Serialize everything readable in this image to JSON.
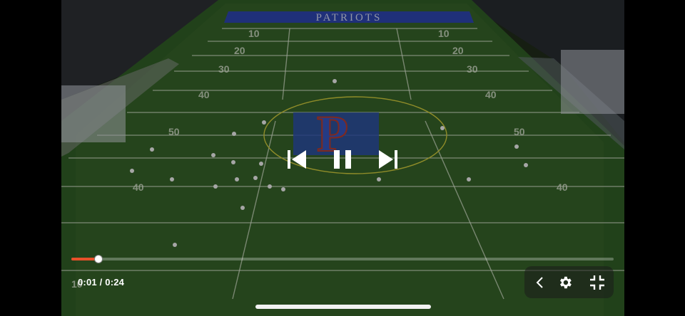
{
  "video": {
    "field_banner_text": "PATRIOTS",
    "field_logo_letter": "P",
    "yard_numbers_left": [
      "10",
      "20",
      "30",
      "40",
      "50",
      "40",
      "10"
    ],
    "yard_numbers_right": [
      "10",
      "20",
      "30",
      "40",
      "50",
      "40"
    ]
  },
  "playback": {
    "current_time": "0:01",
    "separator": " / ",
    "duration": "0:24",
    "progress_fraction": 0.05,
    "progress_color": "#e8502a",
    "state": "paused-overlay-visible"
  },
  "controls": {
    "previous_icon": "skip-previous-icon",
    "pause_icon": "pause-icon",
    "next_icon": "skip-next-icon",
    "collapse_icon": "chevron-left-icon",
    "settings_icon": "gear-icon",
    "exit_fullscreen_icon": "exit-fullscreen-icon"
  }
}
